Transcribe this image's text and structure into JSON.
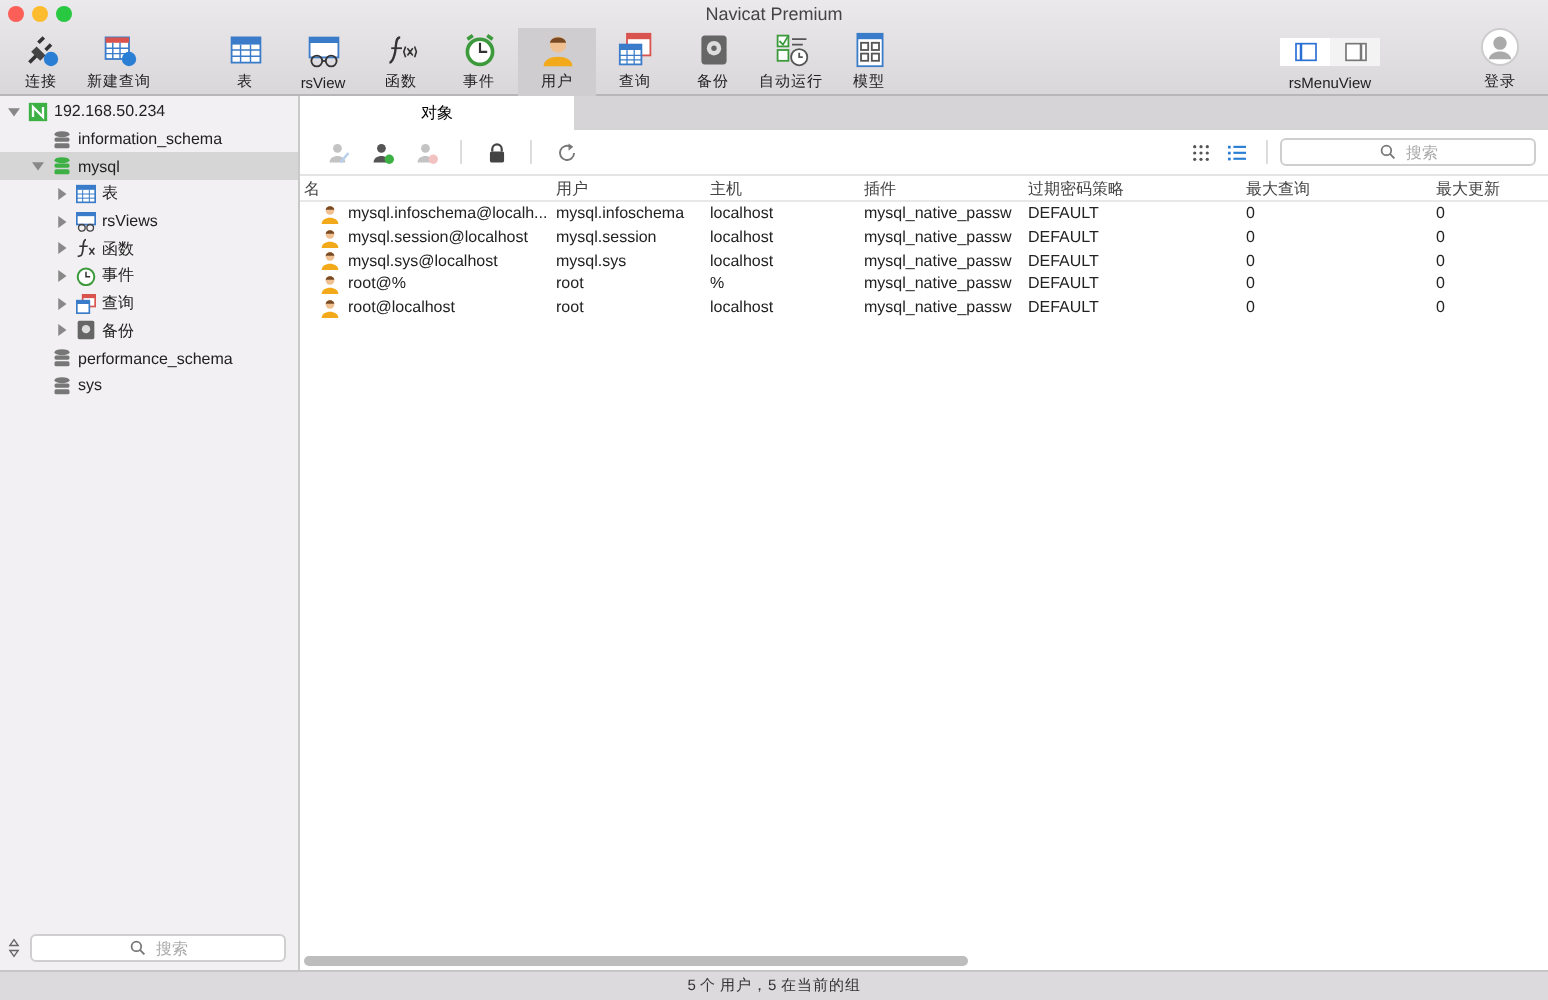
{
  "window": {
    "title": "Navicat Premium"
  },
  "toolbar": {
    "items": [
      {
        "label": "连接",
        "selected": false
      },
      {
        "label": "新建查询",
        "selected": false
      },
      {
        "label": "表",
        "selected": false
      },
      {
        "label": "rsView",
        "selected": false
      },
      {
        "label": "函数",
        "selected": false
      },
      {
        "label": "事件",
        "selected": false
      },
      {
        "label": "用户",
        "selected": true
      },
      {
        "label": "查询",
        "selected": false
      },
      {
        "label": "备份",
        "selected": false
      },
      {
        "label": "自动运行",
        "selected": false
      },
      {
        "label": "模型",
        "selected": false
      }
    ],
    "view_switch": {
      "label": "rsMenuView",
      "segments": [
        {
          "selected": true
        },
        {
          "selected": false
        }
      ]
    },
    "login": {
      "label": "登录"
    }
  },
  "sidebar": {
    "tree": [
      {
        "label": "192.168.50.234",
        "kind": "server",
        "expanded": true,
        "selected": false,
        "children": [
          {
            "label": "information_schema",
            "kind": "database",
            "expanded": false,
            "selected": false
          },
          {
            "label": "mysql",
            "kind": "database",
            "expanded": true,
            "selected": true,
            "children": [
              {
                "label": "表",
                "kind": "table",
                "expanded": false,
                "selected": false
              },
              {
                "label": "rsViews",
                "kind": "view",
                "expanded": false,
                "selected": false
              },
              {
                "label": "函数",
                "kind": "function",
                "expanded": false,
                "selected": false
              },
              {
                "label": "事件",
                "kind": "event",
                "expanded": false,
                "selected": false
              },
              {
                "label": "查询",
                "kind": "query",
                "expanded": false,
                "selected": false
              },
              {
                "label": "备份",
                "kind": "backup",
                "expanded": false,
                "selected": false
              }
            ]
          },
          {
            "label": "performance_schema",
            "kind": "database",
            "expanded": false,
            "selected": false
          },
          {
            "label": "sys",
            "kind": "database",
            "expanded": false,
            "selected": false
          }
        ]
      }
    ],
    "search": {
      "placeholder": "搜索"
    }
  },
  "tabs": [
    {
      "label": "对象",
      "selected": true
    }
  ],
  "object_toolbar": {
    "buttons": [
      {
        "disabled": true
      },
      {
        "disabled": false
      },
      {
        "disabled": true
      },
      {
        "disabled": false
      },
      {
        "disabled": false
      }
    ],
    "views": [
      {
        "selected": false
      },
      {
        "selected": true
      }
    ],
    "search": {
      "placeholder": "搜索"
    }
  },
  "table": {
    "columns": [
      "名",
      "用户",
      "主机",
      "插件",
      "过期密码策略",
      "最大查询",
      "最大更新"
    ],
    "rows": [
      [
        "mysql.infoschema@localh...",
        "mysql.infoschema",
        "localhost",
        "mysql_native_passw",
        "DEFAULT",
        "0",
        "0"
      ],
      [
        "mysql.session@localhost",
        "mysql.session",
        "localhost",
        "mysql_native_passw",
        "DEFAULT",
        "0",
        "0"
      ],
      [
        "mysql.sys@localhost",
        "mysql.sys",
        "localhost",
        "mysql_native_passw",
        "DEFAULT",
        "0",
        "0"
      ],
      [
        "root@%",
        "root",
        "%",
        "mysql_native_passw",
        "DEFAULT",
        "0",
        "0"
      ],
      [
        "root@localhost",
        "root",
        "localhost",
        "mysql_native_passw",
        "DEFAULT",
        "0",
        "0"
      ]
    ]
  },
  "status_bar": {
    "text": "5 个 用户，5 在当前的组"
  }
}
